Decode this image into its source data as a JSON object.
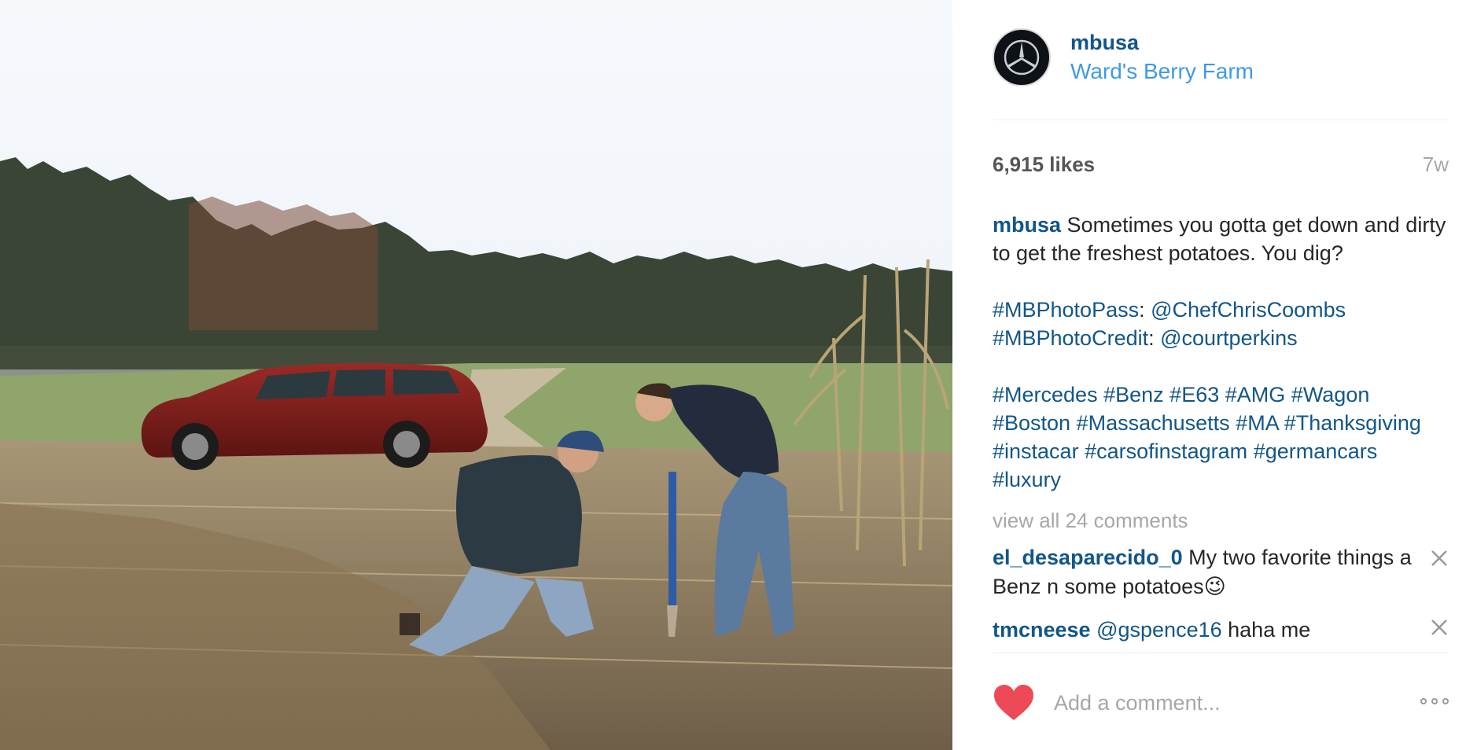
{
  "post": {
    "author": "mbusa",
    "location": "Ward's Berry Farm",
    "likes": "6,915 likes",
    "time": "7w",
    "caption": {
      "username": "mbusa",
      "text": "Sometimes you gotta get down and dirty to get the freshest potatoes. You dig?",
      "credit_lines": [
        {
          "tag": "#MBPhotoPass",
          "mention": "@ChefChrisCoombs"
        },
        {
          "tag": "#MBPhotoCredit",
          "mention": "@courtperkins"
        }
      ],
      "hashtags": [
        "#Mercedes",
        "#Benz",
        "#E63",
        "#AMG",
        "#Wagon",
        "#Boston",
        "#Massachusetts",
        "#MA",
        "#Thanksgiving",
        "#instacar",
        "#carsofinstagram",
        "#germancars",
        "#luxury"
      ]
    },
    "view_all_comments": "view all 24 comments",
    "comments": [
      {
        "username": "el_desaparecido_0",
        "text": "My two favorite things a Benz n some potatoes😉"
      },
      {
        "username": "tmcneese",
        "mention": "@gspence16",
        "text": "haha me"
      }
    ],
    "add_comment_placeholder": "Add a comment...",
    "colors": {
      "link": "#125688",
      "location": "#3f9ae5",
      "muted": "#a5a7aa",
      "heart": "#ed4956"
    },
    "icons": {
      "avatar": "mercedes-star-icon",
      "like": "heart-icon",
      "remove": "close-icon",
      "more": "more-options-icon"
    }
  }
}
